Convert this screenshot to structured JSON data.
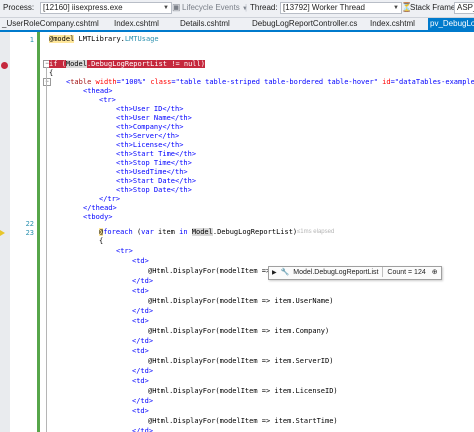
{
  "toolbar": {
    "process_label": "Process:",
    "process_value": "[12160] iisexpress.exe",
    "lifecycle_label": "Lifecycle Events",
    "thread_label": "Thread:",
    "thread_value": "[13792] Worker Thread",
    "stack_frame_label": "Stack Frame:",
    "stack_frame_value": "ASP_"
  },
  "tabs": [
    {
      "label": "_UserRoleCompany.cshtml",
      "active": false
    },
    {
      "label": "Index.cshtml",
      "active": false
    },
    {
      "label": "Details.cshtml",
      "active": false
    },
    {
      "label": "DebugLogReportController.cs",
      "active": false
    },
    {
      "label": "Index.cshtml",
      "active": false
    },
    {
      "label": "pv_DebugLo",
      "active": true
    }
  ],
  "line_numbers": [
    "1",
    "",
    "",
    "",
    "",
    "",
    "",
    "",
    "",
    "",
    "",
    "",
    "",
    "",
    "",
    "",
    "",
    "",
    "",
    "",
    "",
    "22",
    "23",
    "",
    "",
    "",
    "",
    "",
    "",
    "",
    "",
    "",
    "",
    "",
    "",
    "",
    "",
    "",
    "",
    ""
  ],
  "code": {
    "l1_model": "@model",
    "l1_rest": " LMTLibrary.",
    "l1_type": "LMTUsage",
    "l3_if": "if",
    "l3_open": " (",
    "l3_model": "Model",
    "l3_rest": ".DebugLogReportList != null)",
    "l4": "{",
    "l5_open": "<",
    "l5_table": "table",
    "l5_w_attr": " width",
    "l5_w_val": "=\"100%\"",
    "l5_c_attr": " class",
    "l5_c_val": "=\"table table-striped table-bordered table-hover\"",
    "l5_i_attr": " id",
    "l5_i_val": "=\"dataTables-example\"",
    "l5_close": ">",
    "thead_open": "<thead>",
    "tr_open": "<tr>",
    "th_rows": [
      "<th>User ID</th>",
      "<th>User Name</th>",
      "<th>Company</th>",
      "<th>Server</th>",
      "<th>License</th>",
      "<th>Start Time</th>",
      "<th>Stop Time</th>",
      "<th>UsedTime</th>",
      "<th>Start Date</th>",
      "<th>Stop Date</th>"
    ],
    "tr_close": "</tr>",
    "thead_close": "</thead>",
    "tbody_open": "<tbody>",
    "foreach_at": "@",
    "foreach_kw": "foreach",
    "foreach_open": " (",
    "foreach_var": "var",
    "foreach_item": " item ",
    "foreach_in": "in",
    "foreach_model": "Model",
    "foreach_rest": ".DebugLogReportList)",
    "brace_open": "{",
    "td_open": "<td>",
    "td_close": "</td>",
    "displays": [
      "@Html.DisplayFor(modelItem => item.UserId)",
      "@Html.DisplayFor(modelItem => item.UserName)",
      "@Html.DisplayFor(modelItem => item.Company)",
      "@Html.DisplayFor(modelItem => item.ServerID)",
      "@Html.DisplayFor(modelItem => item.LicenseID)",
      "@Html.DisplayFor(modelItem => item.StartTime)"
    ]
  },
  "elapsed_hint": "≤1ms elapsed",
  "datatip": {
    "property": "Model.DebugLogReportList",
    "value": "Count = 124"
  }
}
